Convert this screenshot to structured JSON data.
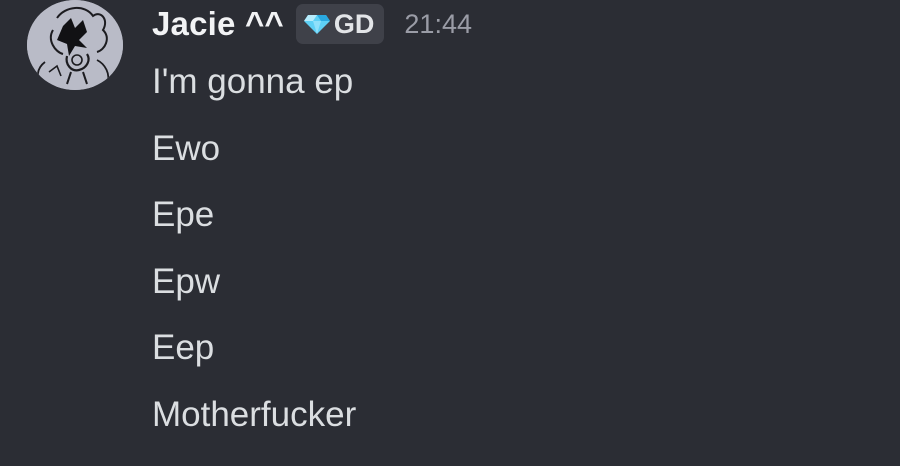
{
  "author": {
    "username": "Jacie ^^",
    "tag": {
      "icon": "diamond-icon",
      "label": "GD"
    },
    "timestamp": "21:44"
  },
  "messages": [
    "I'm gonna ep",
    "Ewo",
    "Epe",
    "Epw",
    "Eep",
    "Motherfucker"
  ],
  "colors": {
    "background": "#2b2d34",
    "username": "#f2f3f5",
    "message_text": "#dbdee1",
    "timestamp": "#9a9ca6",
    "tag_background": "#3f4149",
    "tag_icon": "#5ed0f5"
  }
}
